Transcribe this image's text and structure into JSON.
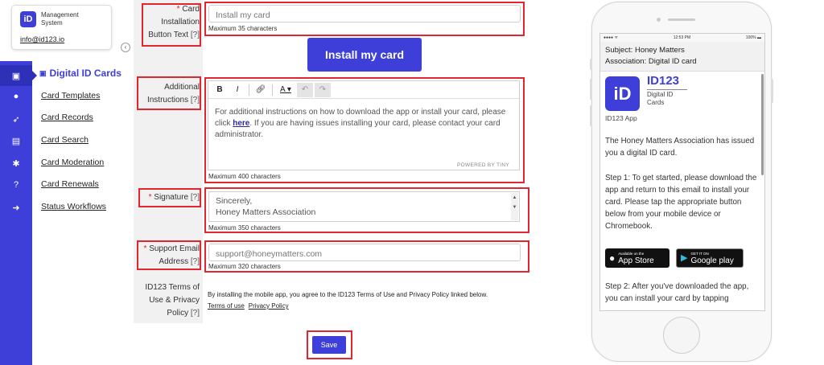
{
  "brand": {
    "badge": "iD",
    "line1": "Management",
    "line2": "System",
    "email": "info@id123.io"
  },
  "subnav": {
    "title": "Digital ID Cards",
    "items": [
      "Card Templates",
      "Card Records",
      "Card Search",
      "Card Moderation",
      "Card Renewals",
      "Status Workflows"
    ]
  },
  "form": {
    "install_text": {
      "label_line1": "Card",
      "label_line2": "Installation",
      "label_line3": "Button Text",
      "value": "Install my card",
      "hint": "Maximum 35 characters"
    },
    "install_button_label": "Install my card",
    "instructions": {
      "label_line1": "Additional",
      "label_line2": "Instructions",
      "body_before": "For additional instructions on how to download the app or install your card, please click ",
      "link": "here",
      "body_after": ". If you are having issues installing your card, please contact your card administrator.",
      "powered": "POWERED BY TINY",
      "hint": "Maximum 400 characters"
    },
    "signature": {
      "label": "Signature",
      "line1": "Sincerely,",
      "line2": "Honey Matters Association",
      "hint": "Maximum 350 characters"
    },
    "support": {
      "label_line1": "Support Email",
      "label_line2": "Address",
      "value": "support@honeymatters.com",
      "hint": "Maximum 320 characters"
    },
    "terms": {
      "label_line1": "ID123 Terms of",
      "label_line2": "Use & Privacy",
      "label_line3": "Policy",
      "text": "By installing the mobile app, you agree to the ID123 Terms of Use and Privacy Policy linked below.",
      "link1": "Terms of use",
      "link2": "Privacy Policy"
    },
    "help_marker": "[?]",
    "required_marker": "*",
    "save_label": "Save"
  },
  "phone": {
    "time": "12:53 PM",
    "battery": "100%",
    "subject": "Subject: Honey Matters",
    "association": "Association:  Digital ID card",
    "logo_glyph": "iD",
    "logo_title": "ID123",
    "logo_sub1": "Digital ID",
    "logo_sub2": "Cards",
    "logo_caption": "ID123 App",
    "para1": "The Honey Matters Association has issued you a digital ID card.",
    "para2": "Step 1: To get started, please download the app and return to this email to install your card. Please tap the appropriate button below from your mobile device or Chromebook.",
    "para3": "Step 2: After you've downloaded the app, you can install your card by tapping",
    "appstore_small": "Available on the",
    "appstore_big": "App Store",
    "play_small": "GET IT ON",
    "play_big": "Google play"
  },
  "colors": {
    "accent": "#3d3fd8",
    "highlight": "#e0262e"
  }
}
